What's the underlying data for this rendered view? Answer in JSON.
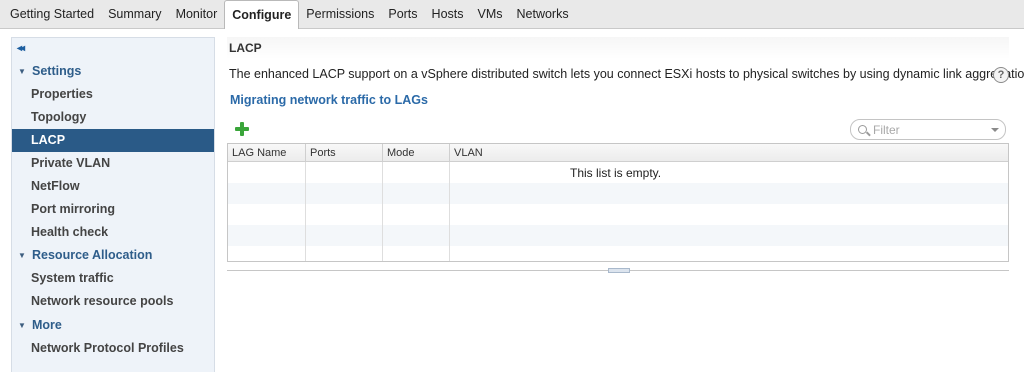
{
  "tabs": [
    {
      "label": "Getting Started"
    },
    {
      "label": "Summary"
    },
    {
      "label": "Monitor"
    },
    {
      "label": "Configure"
    },
    {
      "label": "Permissions"
    },
    {
      "label": "Ports"
    },
    {
      "label": "Hosts"
    },
    {
      "label": "VMs"
    },
    {
      "label": "Networks"
    }
  ],
  "active_tab": "Configure",
  "sidebar": {
    "collapse_glyph": "◂◂",
    "groups": [
      {
        "label": "Settings",
        "items": [
          "Properties",
          "Topology",
          "LACP",
          "Private VLAN",
          "NetFlow",
          "Port mirroring",
          "Health check"
        ]
      },
      {
        "label": "Resource Allocation",
        "items": [
          "System traffic",
          "Network resource pools"
        ]
      },
      {
        "label": "More",
        "items": [
          "Network Protocol Profiles"
        ]
      }
    ],
    "selected_item": "LACP"
  },
  "main": {
    "title": "LACP",
    "description": "The enhanced LACP support on a vSphere distributed switch lets you connect ESXi hosts to physical switches by using dynamic link aggregation.",
    "help_glyph": "?",
    "link": "Migrating network traffic to LAGs",
    "filter_placeholder": "Filter",
    "columns": [
      "LAG Name",
      "Ports",
      "Mode",
      "VLAN"
    ],
    "empty_message": "This list is empty."
  },
  "colors": {
    "selected_bg": "#2a5a87",
    "group_text": "#2e5d8a",
    "link": "#2b6aa8",
    "add_green": "#3aa53a",
    "sidebar_bg": "#eef3f9"
  }
}
